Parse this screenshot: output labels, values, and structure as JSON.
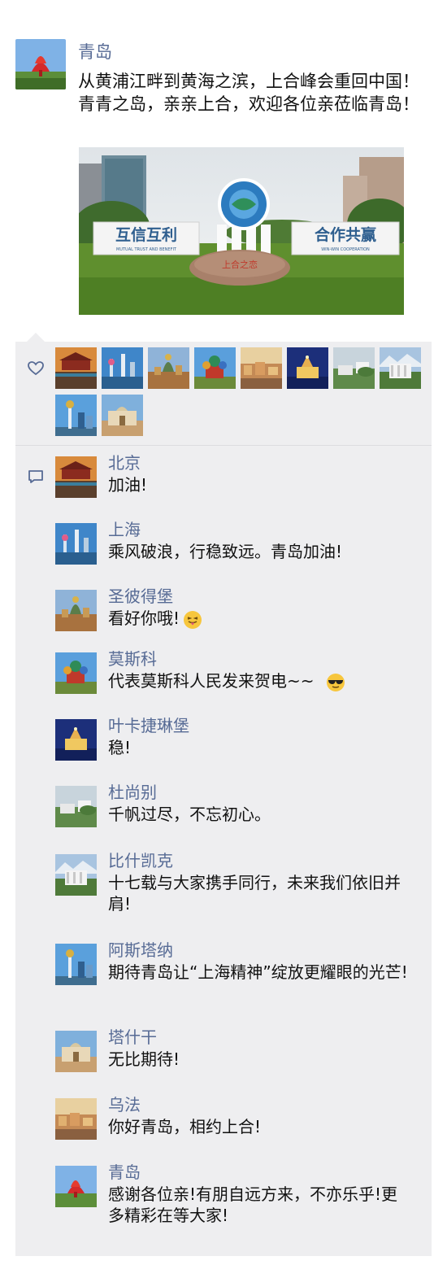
{
  "post": {
    "author": "青岛",
    "text": "从黄浦江畔到黄海之滨，上合峰会重回中国！青青之岛，亲亲上合，欢迎各位亲莅临青岛！",
    "image_banner_left": "互信互利",
    "image_banner_right": "合作共赢",
    "image_banner_left_sub": "MUTUAL TRUST AND BENEFIT",
    "image_banner_right_sub": "WIN-WIN COOPERATION",
    "image_stone": "上合之恋"
  },
  "likes": [
    "北京",
    "上海",
    "圣彼得堡",
    "莫斯科",
    "乌法",
    "叶卡捷琳堡",
    "杜尚别",
    "比什凯克",
    "阿斯塔纳",
    "塔什干"
  ],
  "comments": [
    {
      "name": "北京",
      "text": "加油!"
    },
    {
      "name": "上海",
      "text": "乘风破浪，行稳致远。青岛加油!"
    },
    {
      "name": "圣彼得堡",
      "text": "看好你哦!"
    },
    {
      "name": "莫斯科",
      "text": "代表莫斯科人民发来贺电~~"
    },
    {
      "name": "叶卡捷琳堡",
      "text": "稳!"
    },
    {
      "name": "杜尚别",
      "text": "千帆过尽，不忘初心。"
    },
    {
      "name": "比什凯克",
      "text": "十七载与大家携手同行，未来我们依旧并肩!"
    },
    {
      "name": "阿斯塔纳",
      "text": "期待青岛让“上海精神”绽放更耀眼的光芒!"
    },
    {
      "name": "塔什干",
      "text": "无比期待!"
    },
    {
      "name": "乌法",
      "text": "你好青岛，相约上合!"
    },
    {
      "name": "青岛",
      "text": "感谢各位亲!有朋自远方来，不亦乐乎!更多精彩在等大家!"
    }
  ],
  "colors": {
    "name_link": "#576b95",
    "panel_bg": "#eeeef0"
  },
  "icons": {
    "like": "heart-outline-icon",
    "comment": "speech-bubble-icon",
    "emoji_tongue": "tongue-out-emoji-icon",
    "emoji_sunglasses": "sunglasses-emoji-icon"
  }
}
